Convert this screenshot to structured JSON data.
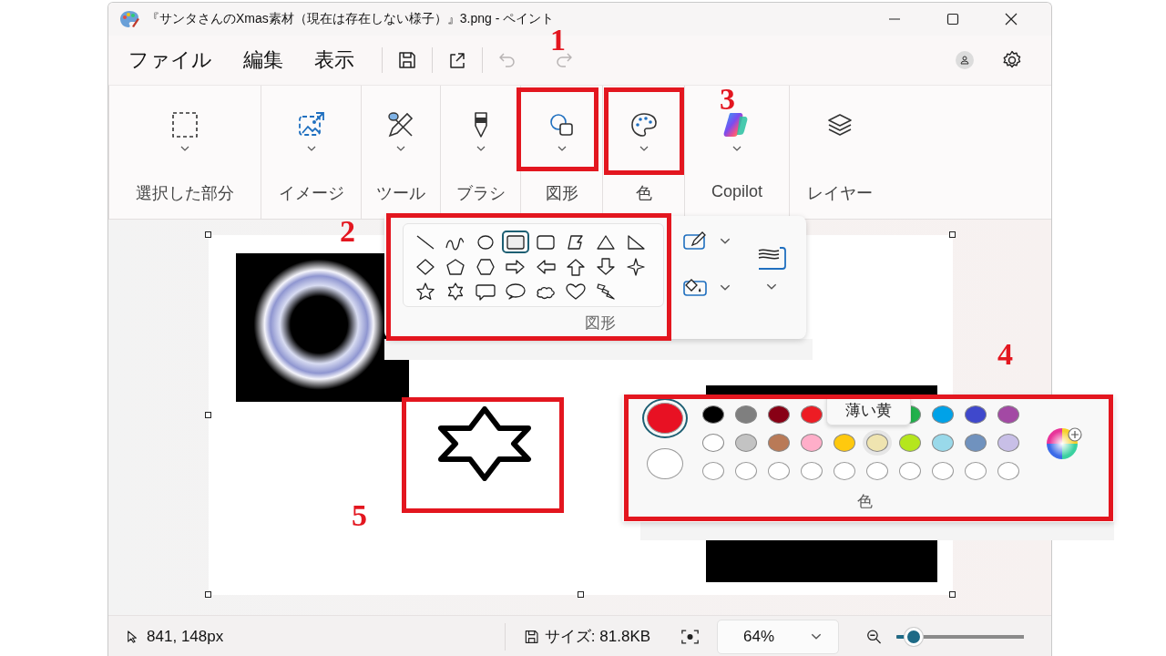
{
  "window": {
    "title": "『サンタさんのXmas素材（現在は存在しない様子）』3.png - ペイント"
  },
  "menu_bar": {
    "menus": [
      {
        "label": "ファイル"
      },
      {
        "label": "編集"
      },
      {
        "label": "表示"
      }
    ],
    "undo": {
      "disabled": true
    },
    "redo": {
      "disabled": true
    }
  },
  "ribbon": {
    "groups": [
      {
        "kind": "selection",
        "label": "選択した部分"
      },
      {
        "kind": "image",
        "label": "イメージ"
      },
      {
        "kind": "tools",
        "label": "ツール"
      },
      {
        "kind": "brush",
        "label": "ブラシ"
      },
      {
        "kind": "shapes",
        "label": "図形"
      },
      {
        "kind": "color",
        "label": "色"
      },
      {
        "kind": "copilot",
        "label": "Copilot"
      },
      {
        "kind": "layers",
        "label": "レイヤー"
      }
    ]
  },
  "shapes_panel": {
    "label": "図形",
    "shapes": [
      {
        "kind": "line",
        "selected": false
      },
      {
        "kind": "curve",
        "selected": false
      },
      {
        "kind": "oval",
        "selected": false
      },
      {
        "kind": "rectangle",
        "selected": true
      },
      {
        "kind": "rounded_rectangle",
        "selected": false
      },
      {
        "kind": "polygon",
        "selected": false
      },
      {
        "kind": "triangle",
        "selected": false
      },
      {
        "kind": "right_triangle",
        "selected": false
      },
      {
        "kind": "diamond",
        "selected": false
      },
      {
        "kind": "pentagon",
        "selected": false
      },
      {
        "kind": "hexagon",
        "selected": false
      },
      {
        "kind": "arrow_right",
        "selected": false
      },
      {
        "kind": "arrow_left",
        "selected": false
      },
      {
        "kind": "arrow_up",
        "selected": false
      },
      {
        "kind": "arrow_down",
        "selected": false
      },
      {
        "kind": "star4",
        "selected": false
      },
      {
        "kind": "star5",
        "selected": false
      },
      {
        "kind": "star6",
        "selected": false
      },
      {
        "kind": "callout_rect",
        "selected": false
      },
      {
        "kind": "callout_oval",
        "selected": false
      },
      {
        "kind": "callout_cloud",
        "selected": false
      },
      {
        "kind": "heart",
        "selected": false
      },
      {
        "kind": "lightning",
        "selected": false
      }
    ]
  },
  "color_panel": {
    "label": "色",
    "tooltip": "薄い黄",
    "primary": {
      "color": "#e81123",
      "selected": true
    },
    "secondary": {
      "color": "#ffffff",
      "selected": false
    },
    "top_row_left": [
      {
        "color": "#000000"
      },
      {
        "color": "#7f7f7f"
      },
      {
        "color": "#880015"
      },
      {
        "color": "#ed1c24"
      }
    ],
    "top_row_right": [
      {
        "color": "#22b14c"
      },
      {
        "color": "#00a2e8"
      },
      {
        "color": "#3f48cc"
      },
      {
        "color": "#a349a4"
      }
    ],
    "second_row": [
      {
        "color": "#ffffff",
        "hovered": false
      },
      {
        "color": "#c3c3c3",
        "hovered": false
      },
      {
        "color": "#b97a57",
        "hovered": false
      },
      {
        "color": "#ffaec9",
        "hovered": false
      },
      {
        "color": "#ffc90e",
        "hovered": false
      },
      {
        "color": "#efe4b0",
        "hovered": true
      },
      {
        "color": "#b5e61d",
        "hovered": false
      },
      {
        "color": "#99d9ea",
        "hovered": false
      },
      {
        "color": "#7092be",
        "hovered": false
      },
      {
        "color": "#c8bfe7",
        "hovered": false
      }
    ]
  },
  "annotations": [
    {
      "label": "1"
    },
    {
      "label": "2"
    },
    {
      "label": "3"
    },
    {
      "label": "4"
    },
    {
      "label": "5"
    }
  ],
  "status_bar": {
    "position": "841, 148px",
    "file_size": "サイズ: 81.8KB",
    "zoom": "64%",
    "zoom_slider": {
      "level": 0.12
    }
  }
}
